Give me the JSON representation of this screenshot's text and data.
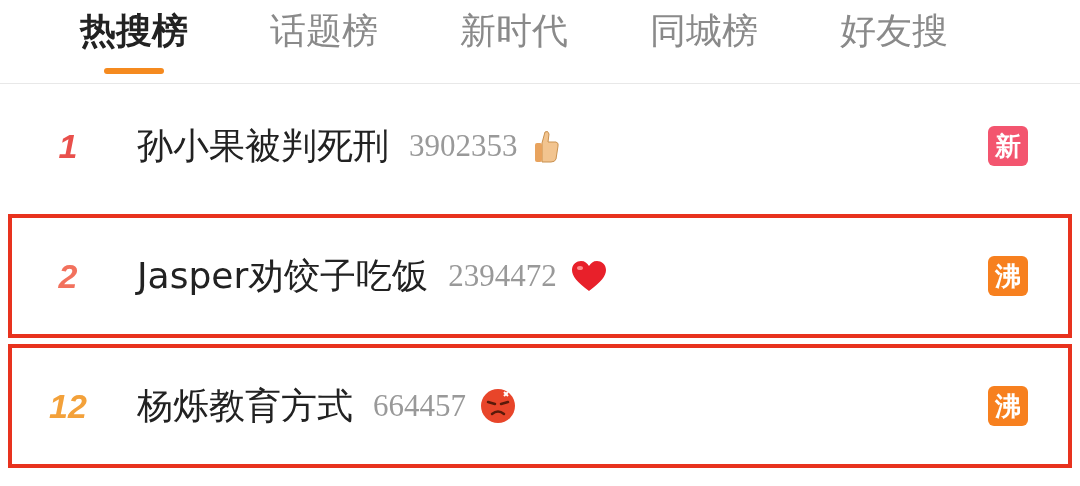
{
  "tabs": [
    {
      "label": "热搜榜",
      "selected": true
    },
    {
      "label": "话题榜",
      "selected": false
    },
    {
      "label": "新时代",
      "selected": false
    },
    {
      "label": "同城榜",
      "selected": false
    },
    {
      "label": "好友搜",
      "selected": false
    }
  ],
  "rows": [
    {
      "rank": {
        "text": "1",
        "color": "#e9504c"
      },
      "title": "孙小果被判死刑",
      "count": "3902353",
      "kind": "thumbs-up",
      "badge": {
        "text": "新",
        "color": "#f3556f"
      },
      "highlighted": false
    },
    {
      "rank": {
        "text": "2",
        "color": "#f2715d"
      },
      "title": "Jasper劝饺子吃饭",
      "count": "2394472",
      "kind": "heart",
      "badge": {
        "text": "沸",
        "color": "#f7801f"
      },
      "highlighted": true
    },
    {
      "rank": {
        "text": "12",
        "color": "#f3a13a"
      },
      "title": "杨烁教育方式",
      "count": "664457",
      "kind": "angry-face",
      "badge": {
        "text": "沸",
        "color": "#f7801f"
      },
      "highlighted": true
    }
  ]
}
